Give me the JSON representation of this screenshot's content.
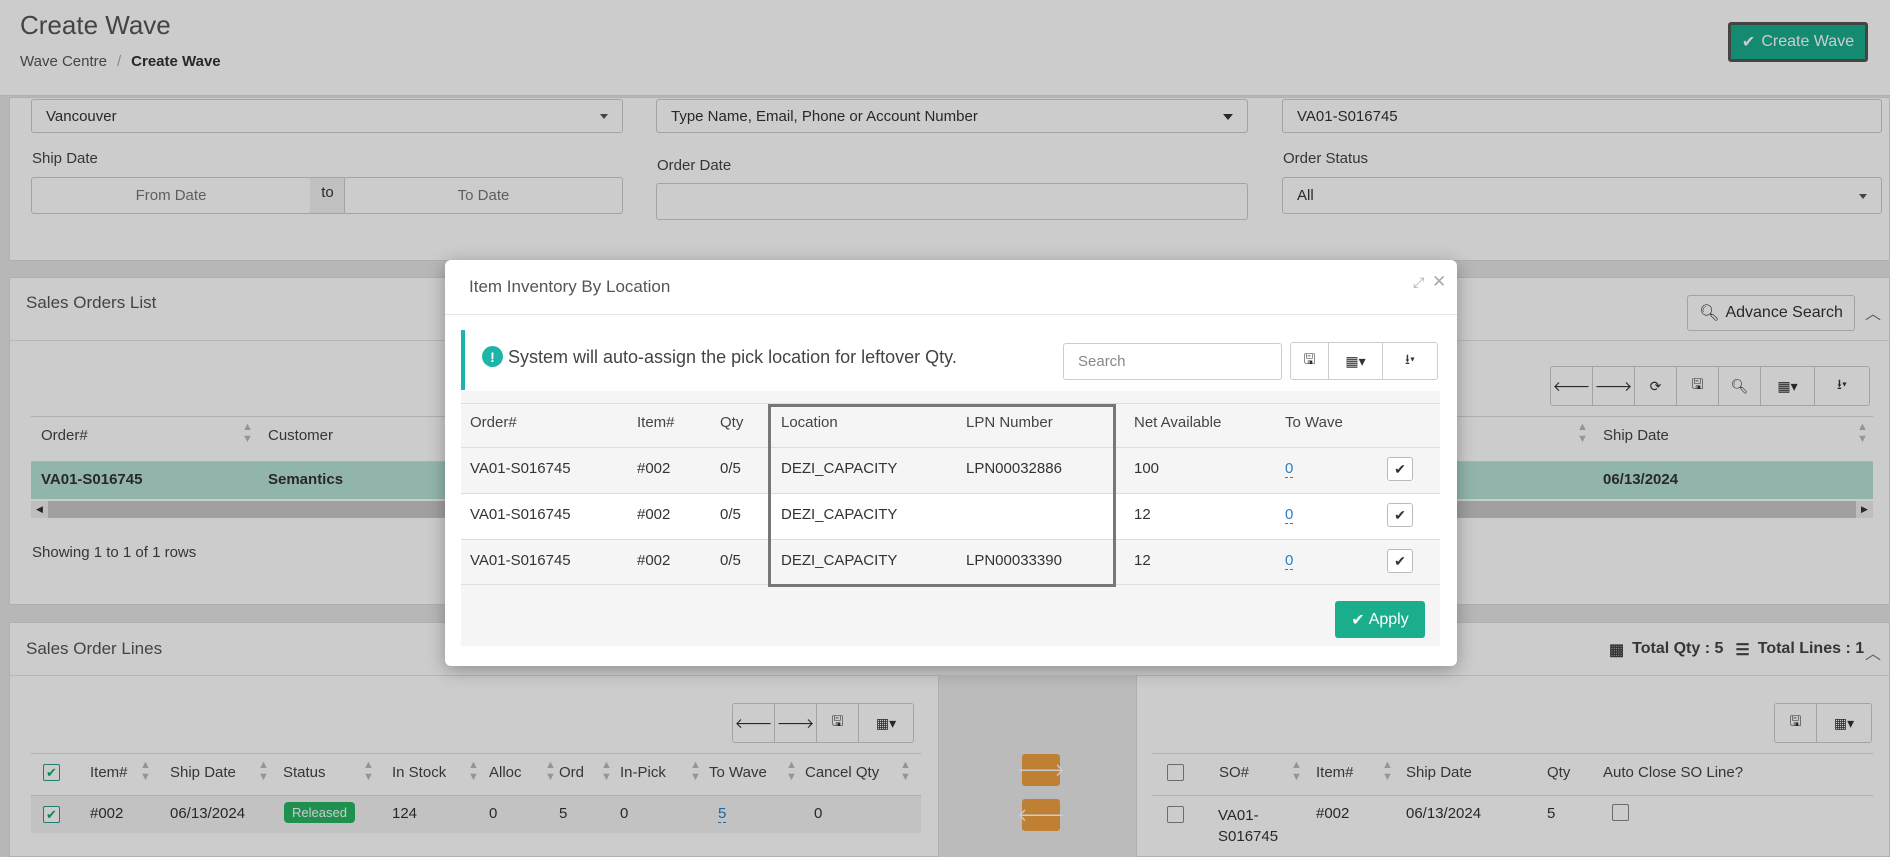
{
  "header": {
    "title": "Create Wave",
    "breadcrumb": [
      "Wave Centre",
      "Create Wave"
    ],
    "create_wave_button": "Create Wave"
  },
  "filters": {
    "warehouse": "Vancouver",
    "customer_placeholder": "Type Name, Email, Phone or Account Number",
    "order_number": "VA01-S016745",
    "ship_date_label": "Ship Date",
    "from_date_placeholder": "From Date",
    "to_label": "to",
    "to_date_placeholder": "To Date",
    "order_date_label": "Order Date",
    "order_status_label": "Order Status",
    "order_status_value": "All"
  },
  "sales_orders": {
    "title": "Sales Orders List",
    "advance_search": "Advance Search",
    "columns": [
      "Order#",
      "Customer",
      "Ship Date"
    ],
    "row": {
      "order": "VA01-S016745",
      "customer": "Semantics",
      "ship_date": "06/13/2024"
    },
    "showing": "Showing 1 to 1 of 1 rows"
  },
  "sales_order_lines": {
    "title": "Sales Order Lines",
    "columns": [
      "Item#",
      "Ship Date",
      "Status",
      "In Stock",
      "Alloc",
      "Ord",
      "In-Pick",
      "To Wave",
      "Cancel Qty"
    ],
    "row": {
      "item": "#002",
      "ship_date": "06/13/2024",
      "status": "Released",
      "in_stock": "124",
      "alloc": "0",
      "ord": "5",
      "in_pick": "0",
      "to_wave": "5",
      "cancel_qty": "0"
    }
  },
  "wave_lines": {
    "total_qty": "Total Qty : 5",
    "total_lines": "Total Lines : 1",
    "columns": [
      "SO#",
      "Item#",
      "Ship Date",
      "Qty",
      "Auto Close SO Line?"
    ],
    "row": {
      "so": "VA01-\nS016745",
      "so_line1": "VA01-",
      "so_line2": "S016745",
      "item": "#002",
      "ship_date": "06/13/2024",
      "qty": "5"
    }
  },
  "modal": {
    "title": "Item Inventory By Location",
    "alert": "System will auto-assign the pick location for leftover Qty.",
    "search_placeholder": "Search",
    "columns": [
      "Order#",
      "Item#",
      "Qty",
      "Location",
      "LPN Number",
      "Net Available",
      "To Wave"
    ],
    "rows": [
      {
        "order": "VA01-S016745",
        "item": "#002",
        "qty": "0/5",
        "location": "DEZI_CAPACITY",
        "lpn": "LPN00032886",
        "net": "100",
        "to_wave": "0"
      },
      {
        "order": "VA01-S016745",
        "item": "#002",
        "qty": "0/5",
        "location": "DEZI_CAPACITY",
        "lpn": "",
        "net": "12",
        "to_wave": "0"
      },
      {
        "order": "VA01-S016745",
        "item": "#002",
        "qty": "0/5",
        "location": "DEZI_CAPACITY",
        "lpn": "LPN00033390",
        "net": "12",
        "to_wave": "0"
      }
    ],
    "apply": "Apply"
  },
  "colors": {
    "accent": "#1aae8d",
    "selected_row": "#b6e3d8",
    "orange": "#f0a040",
    "link": "#2a7fc4"
  }
}
